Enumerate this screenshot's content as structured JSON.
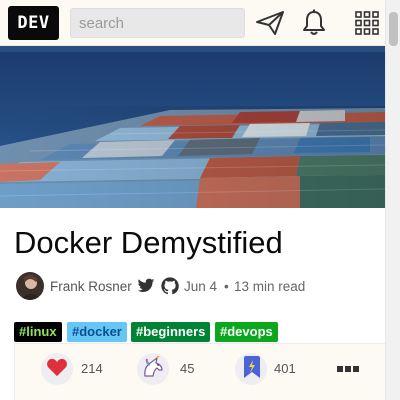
{
  "header": {
    "logo_text": "DEV",
    "search_placeholder": "search",
    "icons": [
      "send-icon",
      "bell-icon",
      "menu-grid-icon"
    ]
  },
  "article": {
    "cover_alt": "Container ship deck at sea",
    "title": "Docker Demystified",
    "author": "Frank Rosner",
    "date": "Jun 4",
    "separator": "•",
    "read_time": "13 min read",
    "tags": [
      "#linux",
      "#docker",
      "#beginners",
      "#devops"
    ]
  },
  "reactions": {
    "hearts": "214",
    "unicorns": "45",
    "saves": "401"
  },
  "colors": {
    "tag_linux_bg": "#000000",
    "tag_linux_fg": "#93e25a",
    "tag_docker_bg": "#66c6f5",
    "tag_beginners_bg": "#008335",
    "tag_devops_bg": "#0ba71d",
    "heart": "#e0303d"
  }
}
